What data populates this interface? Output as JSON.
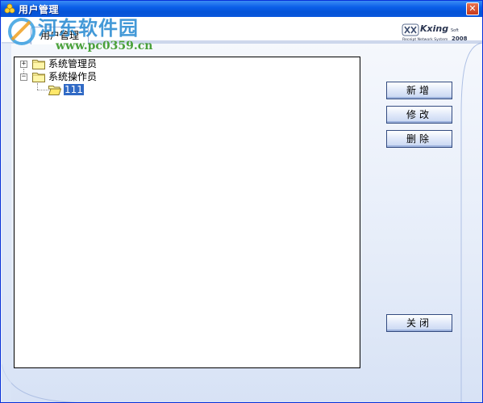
{
  "window": {
    "title": "用户管理"
  },
  "tab": {
    "label": "用户管理"
  },
  "logo": {
    "brand": "Kxing",
    "brand_suffix": "Soft",
    "tagline": "Receipt Network System",
    "year": "2008"
  },
  "watermark": {
    "name": "河东软件园",
    "url": "www.pc0359.cn"
  },
  "tree": {
    "nodes": [
      {
        "label": "系统管理员",
        "expanded": false,
        "icon": "folder-closed-icon"
      },
      {
        "label": "系统操作员",
        "expanded": true,
        "icon": "folder-closed-icon",
        "children": [
          {
            "label": "111",
            "selected": true,
            "icon": "folder-open-icon"
          }
        ]
      }
    ]
  },
  "buttons": {
    "add": "新增",
    "edit": "修改",
    "delete": "删除",
    "close": "关闭"
  },
  "colors": {
    "titlebar": "#0a5ee8",
    "selection": "#316ac5",
    "button_border": "#334b80"
  }
}
